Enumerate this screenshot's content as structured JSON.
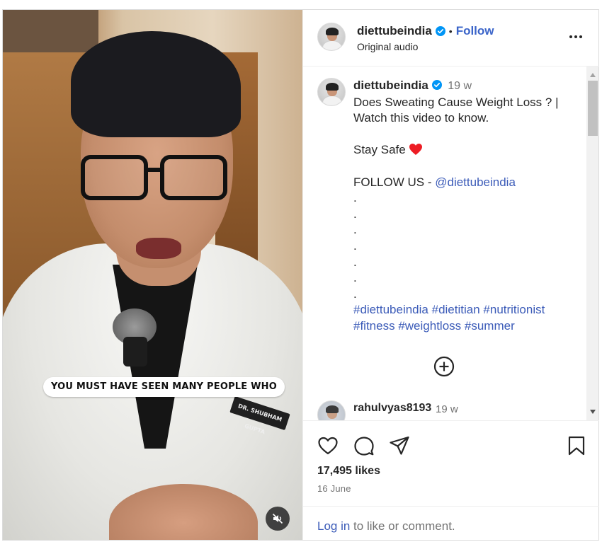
{
  "colors": {
    "link": "#3b5bb8",
    "verified": "#0095f6",
    "heart_red": "#ed1c24",
    "muted_text": "#737373",
    "primary_text": "#262626"
  },
  "video": {
    "caption_overlay": "YOU MUST HAVE SEEN MANY PEOPLE WHO",
    "badge_text": "DR. SHUBHAM GUPTA",
    "mute_icon": "speaker-muted-icon"
  },
  "header": {
    "username": "diettubeindia",
    "separator": "•",
    "follow_label": "Follow",
    "subtitle": "Original audio",
    "more_icon": "more-options-icon"
  },
  "post": {
    "username": "diettubeindia",
    "time_ago": "19 w",
    "caption_line1": "Does Sweating Cause Weight Loss ? |",
    "caption_line2": "Watch this video to know.",
    "stay_safe": "Stay Safe",
    "follow_us_prefix": "FOLLOW US - ",
    "follow_us_handle": "@diettubeindia",
    "dots": [
      ".",
      ".",
      ".",
      ".",
      ".",
      ".",
      "."
    ],
    "hashtags_line1": [
      "#diettubeindia",
      "#dietitian",
      "#nutritionist"
    ],
    "hashtags_line2": [
      "#fitness",
      "#weightloss",
      "#summer"
    ]
  },
  "comment": {
    "username": "rahulvyas8193",
    "time_ago": "19 w"
  },
  "footer": {
    "likes": "17,495 likes",
    "date": "16 June",
    "login_link": "Log in",
    "login_rest": " to like or comment."
  }
}
